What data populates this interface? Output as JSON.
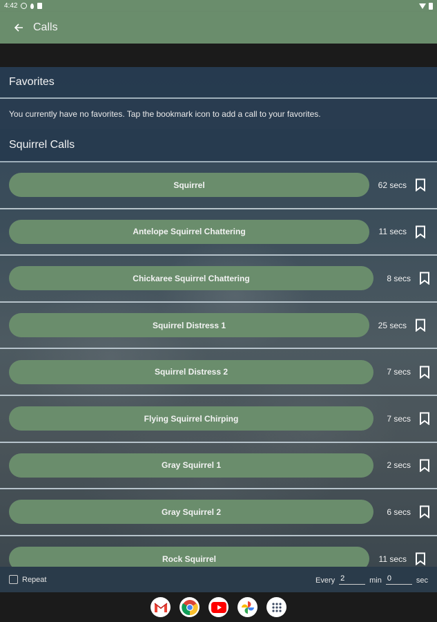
{
  "status_bar": {
    "time": "4:42"
  },
  "app_bar": {
    "title": "Calls"
  },
  "favorites": {
    "header": "Favorites",
    "message": "You currently have no favorites. Tap the bookmark icon to add a call to your favorites."
  },
  "squirrel_calls": {
    "header": "Squirrel Calls",
    "items": [
      {
        "name": "Squirrel",
        "duration": "62 secs"
      },
      {
        "name": "Antelope Squirrel Chattering",
        "duration": "11 secs"
      },
      {
        "name": "Chickaree Squirrel Chattering",
        "duration": "8 secs"
      },
      {
        "name": "Squirrel Distress 1",
        "duration": "25 secs"
      },
      {
        "name": "Squirrel Distress 2",
        "duration": "7 secs"
      },
      {
        "name": "Flying Squirrel Chirping",
        "duration": "7 secs"
      },
      {
        "name": "Gray Squirrel 1",
        "duration": "2 secs"
      },
      {
        "name": "Gray Squirrel 2",
        "duration": "6 secs"
      },
      {
        "name": "Rock Squirrel",
        "duration": "11 secs"
      }
    ]
  },
  "bottom_bar": {
    "repeat_label": "Repeat",
    "every_label": "Every",
    "minutes_value": "2",
    "min_label": "min",
    "seconds_value": "0",
    "sec_label": "sec"
  },
  "taskbar": {
    "apps": [
      "gmail-icon",
      "chrome-icon",
      "youtube-icon",
      "photos-icon",
      "app-drawer-icon"
    ]
  },
  "colors": {
    "accent_green": "#6a8d6c",
    "section_blue": "#233b4b",
    "taskbar": "#1b1b1b"
  }
}
